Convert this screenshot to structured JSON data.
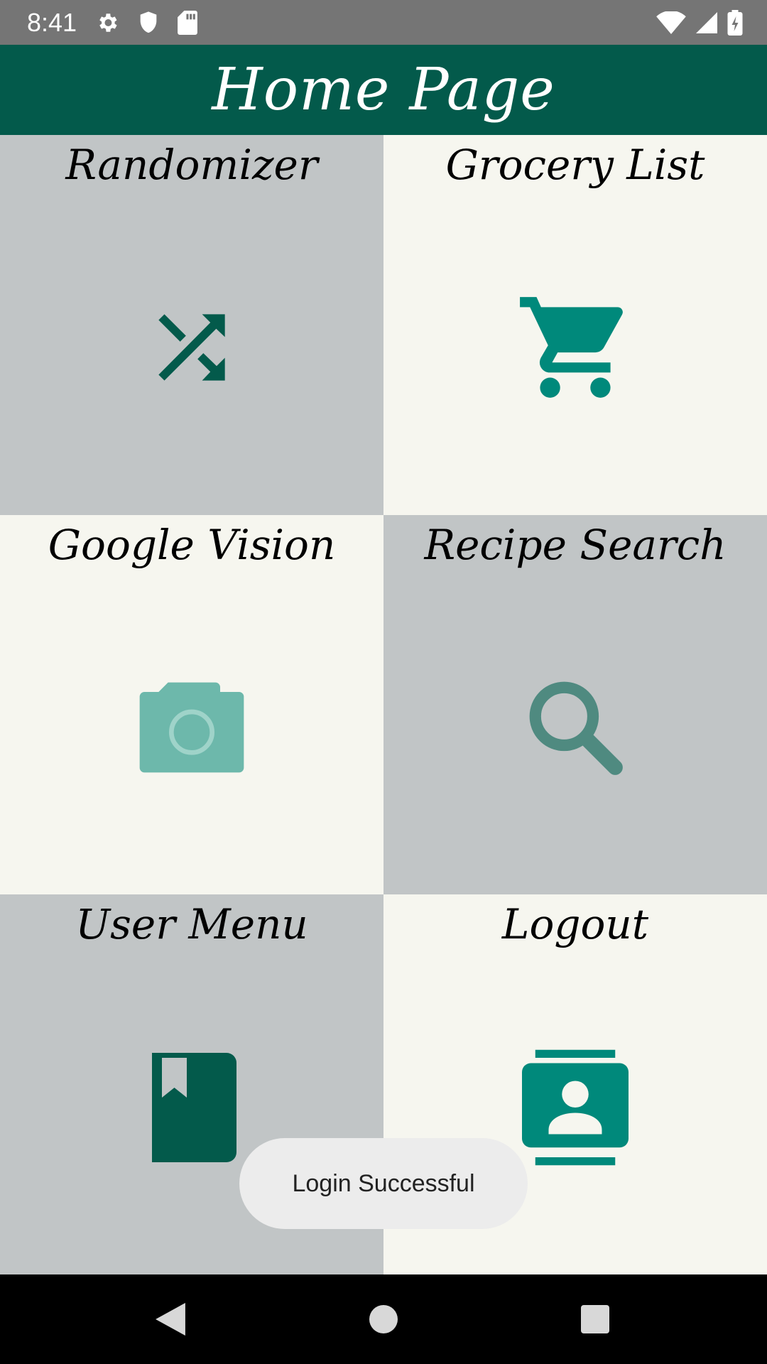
{
  "status_bar": {
    "time": "8:41",
    "icons": [
      "gear-icon",
      "shield-icon",
      "sd-card-icon",
      "wifi-icon",
      "signal-icon",
      "battery-icon"
    ]
  },
  "app_bar": {
    "title": "Home Page",
    "background": "#035a4b"
  },
  "tiles": [
    {
      "label": "Randomizer",
      "icon": "shuffle-icon",
      "background": "#c1c5c6"
    },
    {
      "label": "Grocery List",
      "icon": "cart-icon",
      "background": "#f6f6ef"
    },
    {
      "label": "Google Vision",
      "icon": "camera-icon",
      "background": "#f6f6ef"
    },
    {
      "label": "Recipe Search",
      "icon": "search-icon",
      "background": "#c1c5c6"
    },
    {
      "label": "User Menu",
      "icon": "book-icon",
      "background": "#c1c5c6"
    },
    {
      "label": "Logout",
      "icon": "contact-icon",
      "background": "#f6f6ef"
    }
  ],
  "toast": {
    "text": "Login Successful"
  },
  "nav_bar": {
    "buttons": [
      "back-icon",
      "home-icon",
      "recents-icon"
    ]
  },
  "colors": {
    "accent_dark": "#035a4b",
    "accent": "#00897b",
    "accent_light": "#6db8ab"
  }
}
